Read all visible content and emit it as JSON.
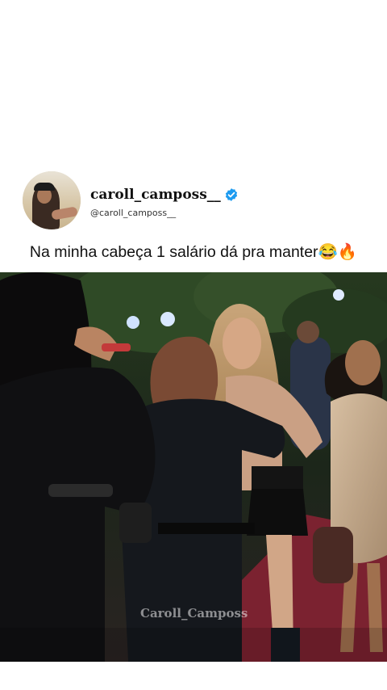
{
  "profile": {
    "display_name": "caroll_camposs__",
    "handle": "@caroll_camposs__",
    "verified": true
  },
  "post": {
    "caption": "Na minha cabeça 1 salário dá pra manter😂🔥"
  },
  "video": {
    "watermark": "Caroll_Camposs"
  },
  "icons": {
    "verified": "verified-badge-icon"
  },
  "colors": {
    "verified_badge": "#1d9bf0",
    "background": "#ffffff"
  }
}
